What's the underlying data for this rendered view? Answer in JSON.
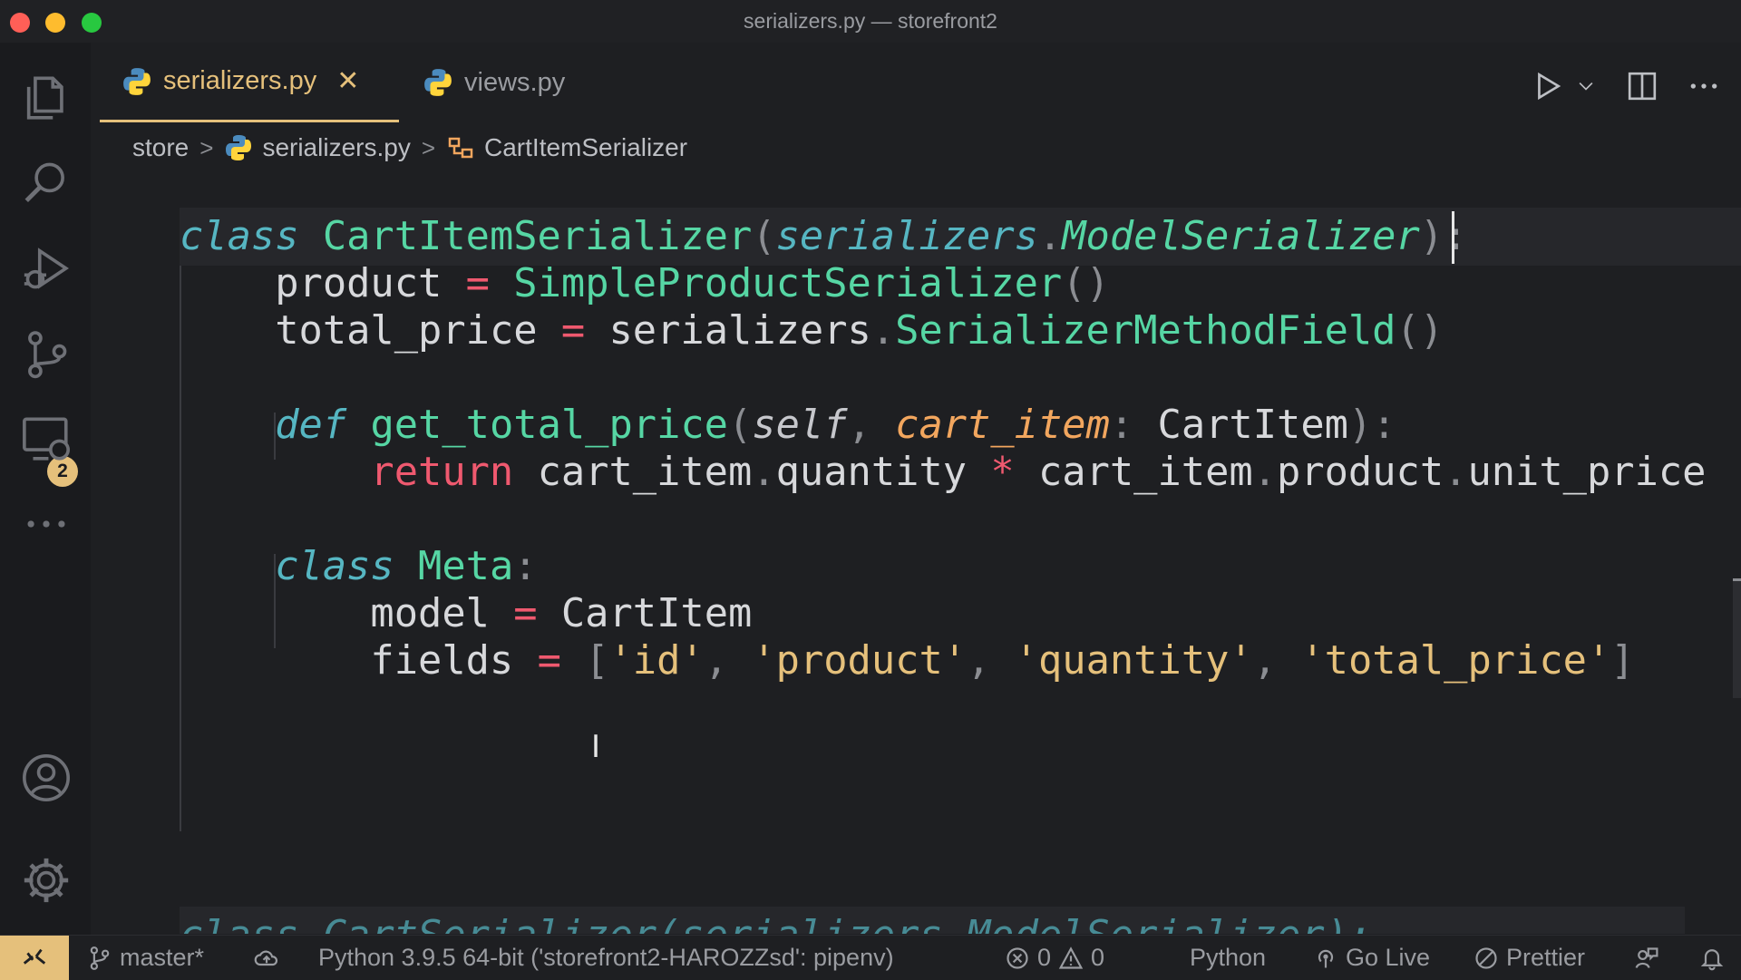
{
  "window": {
    "title": "serializers.py — storefront2"
  },
  "activity_bar": {
    "scm_badge": "2"
  },
  "tabs": [
    {
      "label": "serializers.py",
      "active": true,
      "close_glyph": "✕"
    },
    {
      "label": "views.py",
      "active": false
    }
  ],
  "breadcrumb": {
    "folder": "store",
    "file": "serializers.py",
    "symbol": "CartItemSerializer",
    "separator": ">"
  },
  "code": {
    "l1": {
      "kw": "class",
      "name": "CartItemSerializer",
      "p1": "(",
      "base_mod": "serializers",
      "dot": ".",
      "base_cls": "ModelSerializer",
      "p2": "):"
    },
    "l2": {
      "var": "product",
      "eq": "=",
      "cls": "SimpleProductSerializer",
      "call": "()"
    },
    "l3": {
      "var": "total_price",
      "eq": "=",
      "mod": "serializers",
      "dot": ".",
      "cls": "SerializerMethodField",
      "call": "()"
    },
    "l5": {
      "kw": "def",
      "fn": "get_total_price",
      "p1": "(",
      "self": "self",
      "comma": ",",
      "param": "cart_item",
      "colon": ":",
      "type": "CartItem",
      "p2": "):"
    },
    "l6": {
      "kw": "return",
      "a": "cart_item",
      "d1": ".",
      "b": "quantity",
      "op": "*",
      "c": "cart_item",
      "d2": ".",
      "d": "product",
      "d3": ".",
      "e": "unit_price"
    },
    "l8": {
      "kw": "class",
      "name": "Meta",
      "colon": ":"
    },
    "l9": {
      "var": "model",
      "eq": "=",
      "val": "CartItem"
    },
    "l10": {
      "var": "fields",
      "eq": "=",
      "ob": "[",
      "s1": "'id'",
      "s2": "'product'",
      "s3": "'quantity'",
      "s4": "'total_price'",
      "comma": ",",
      "cb": "]"
    },
    "sticky": "class CartSerializer(serializers.ModelSerializer):"
  },
  "status_bar": {
    "branch": "master*",
    "interpreter": "Python 3.9.5 64-bit ('storefront2-HAROZZsd': pipenv)",
    "errors": "0",
    "warnings": "0",
    "language": "Python",
    "go_live": "Go Live",
    "prettier": "Prettier"
  },
  "colors": {
    "accent": "#e5c07b",
    "keyword": "#56b6c2",
    "class": "#56d6a4",
    "operator": "#ef596f",
    "param": "#f2a65e"
  }
}
